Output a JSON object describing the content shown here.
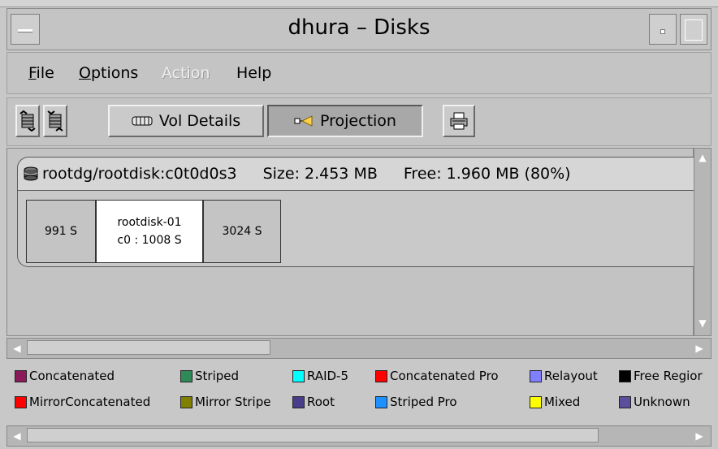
{
  "window": {
    "title": "dhura – Disks"
  },
  "menu": [
    {
      "label": "File",
      "disabled": false
    },
    {
      "label": "Options",
      "disabled": false
    },
    {
      "label": "Action",
      "disabled": true
    },
    {
      "label": "Help",
      "disabled": false
    }
  ],
  "toolbar": {
    "vol_details_label": "Vol Details",
    "projection_label": "Projection",
    "icons": [
      "expand-disk-icon",
      "collapse-disk-icon",
      "volume-icon",
      "projection-icon",
      "printer-icon"
    ]
  },
  "disk": {
    "name": "rootdg/rootdisk:c0t0d0s3",
    "size": "Size: 2.453 MB",
    "free": "Free: 1.960 MB (80%)",
    "subdisks": [
      {
        "line1": "",
        "line2": "991 S",
        "selected": false
      },
      {
        "line1": "rootdisk-01",
        "line2": "c0 : 1008 S",
        "selected": true
      },
      {
        "line1": "",
        "line2": "3024 S",
        "selected": false
      }
    ]
  },
  "legend": [
    {
      "label": "Concatenated",
      "color": "#8b1a5a"
    },
    {
      "label": "Striped",
      "color": "#2e8b57"
    },
    {
      "label": "RAID-5",
      "color": "#00ffff"
    },
    {
      "label": "Concatenated Pro",
      "color": "#ff0000"
    },
    {
      "label": "Relayout",
      "color": "#8080ff"
    },
    {
      "label": "Free Regior",
      "color": "#000000"
    },
    {
      "label": "MirrorConcatenated",
      "color": "#ff0000"
    },
    {
      "label": "Mirror Stripe",
      "color": "#808000"
    },
    {
      "label": "Root",
      "color": "#483d8b"
    },
    {
      "label": "Striped Pro",
      "color": "#1e90ff"
    },
    {
      "label": "Mixed",
      "color": "#ffff00"
    },
    {
      "label": "Unknown",
      "color": "#5b4e9a"
    }
  ]
}
